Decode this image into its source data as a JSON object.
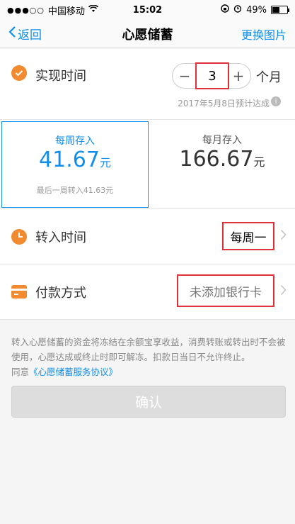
{
  "status_bar": {
    "carrier": "中国移动",
    "time": "15:02",
    "battery": "49%",
    "battery_level": 0.49
  },
  "nav": {
    "back_label": "返回",
    "title": "心愿储蓄",
    "right_label": "更换图片"
  },
  "realize": {
    "label": "实现时间",
    "minus": "−",
    "value": "3",
    "plus": "+",
    "unit": "个月",
    "eta": "2017年5月8日预计达成",
    "info": "i"
  },
  "weekly": {
    "label": "每周存入",
    "amount": "41.67",
    "unit": "元",
    "note": "最后一周转入41.63元"
  },
  "monthly": {
    "label": "每月存入",
    "amount": "166.67",
    "unit": "元"
  },
  "transfer": {
    "label": "转入时间",
    "value": "每周一"
  },
  "payment": {
    "label": "付款方式",
    "value": "未添加银行卡"
  },
  "notice": {
    "text": "转入心愿储蓄的资金将冻结在余额宝享收益，消费转账或转出时不会被使用，心愿达成或终止时即可解冻。扣款日当日不允许终止。",
    "agree_prefix": "同意",
    "agree_link": "《心愿储蓄服务协议》"
  },
  "confirm": {
    "label": "确认"
  },
  "colors": {
    "accent": "#108ee9",
    "orange": "#f28b30",
    "highlight": "#e0303a"
  }
}
